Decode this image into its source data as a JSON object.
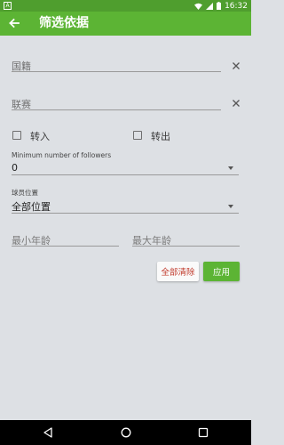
{
  "status_bar": {
    "time": "16:32",
    "notification": "A"
  },
  "app_bar": {
    "title": "筛选依据"
  },
  "form": {
    "nationality_placeholder": "国籍",
    "league_placeholder": "联赛",
    "transfer_in_label": "转入",
    "transfer_out_label": "转出",
    "transfer_in_checked": false,
    "transfer_out_checked": false,
    "followers_label": "Minimum number of followers",
    "followers_value": "0",
    "position_label": "球员位置",
    "position_value": "全部位置",
    "min_age_placeholder": "最小年龄",
    "max_age_placeholder": "最大年龄"
  },
  "actions": {
    "clear_all": "全部清除",
    "apply": "应用"
  },
  "colors": {
    "status_bar": "#4f9e2e",
    "app_bar": "#5cb434",
    "background": "#dde0e4",
    "clear_text": "#c0392b"
  }
}
